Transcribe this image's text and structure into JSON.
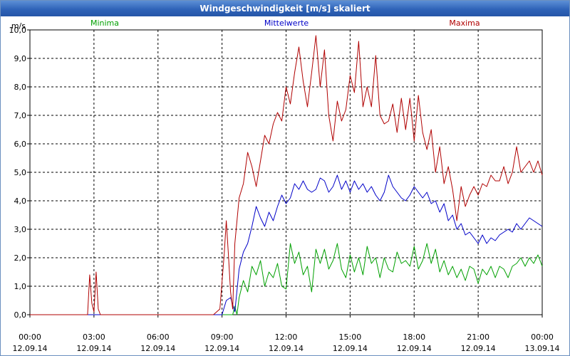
{
  "window": {
    "title": "Windgeschwindigkeit [m/s] skaliert"
  },
  "chart_data": {
    "type": "line",
    "title": "Windgeschwindigkeit [m/s] skaliert",
    "ylabel": "m/s",
    "ylim": [
      0,
      10
    ],
    "xlim": [
      0,
      24
    ],
    "grid": true,
    "legend_placement": "top",
    "y_ticks": [
      "0,0",
      "1,0",
      "2,0",
      "3,0",
      "4,0",
      "5,0",
      "6,0",
      "7,0",
      "8,0",
      "9,0",
      "10,0"
    ],
    "x_ticks": [
      {
        "time": "00:00",
        "date": "12.09.14"
      },
      {
        "time": "03:00",
        "date": "12.09.14"
      },
      {
        "time": "06:00",
        "date": "12.09.14"
      },
      {
        "time": "09:00",
        "date": "12.09.14"
      },
      {
        "time": "12:00",
        "date": "12.09.14"
      },
      {
        "time": "15:00",
        "date": "12.09.14"
      },
      {
        "time": "18:00",
        "date": "12.09.14"
      },
      {
        "time": "21:00",
        "date": "12.09.14"
      },
      {
        "time": "00:00",
        "date": "13.09.14"
      }
    ],
    "series": [
      {
        "name": "Minima",
        "color": "#00a000",
        "x": [
          0,
          9.3,
          9.5,
          9.6,
          9.7,
          9.8,
          10.0,
          10.2,
          10.4,
          10.6,
          10.8,
          11.0,
          11.2,
          11.4,
          11.6,
          11.8,
          12.0,
          12.2,
          12.4,
          12.6,
          12.8,
          13.0,
          13.2,
          13.4,
          13.6,
          13.8,
          14.0,
          14.2,
          14.4,
          14.6,
          14.8,
          15.0,
          15.2,
          15.4,
          15.6,
          15.8,
          16.0,
          16.2,
          16.4,
          16.6,
          16.8,
          17.0,
          17.2,
          17.4,
          17.6,
          17.8,
          18.0,
          18.2,
          18.4,
          18.6,
          18.8,
          19.0,
          19.2,
          19.4,
          19.6,
          19.8,
          20.0,
          20.2,
          20.4,
          20.6,
          20.8,
          21.0,
          21.2,
          21.4,
          21.6,
          21.8,
          22.0,
          22.2,
          22.4,
          22.6,
          22.8,
          23.0,
          23.2,
          23.4,
          23.6,
          23.8,
          24.0
        ],
        "values": [
          0,
          0,
          0,
          0.3,
          0,
          0.6,
          1.2,
          0.8,
          1.7,
          1.4,
          1.9,
          1.0,
          1.5,
          1.3,
          1.8,
          1.0,
          0.9,
          2.5,
          1.8,
          2.2,
          1.4,
          1.7,
          0.8,
          2.3,
          1.8,
          2.3,
          1.6,
          1.9,
          2.5,
          1.6,
          1.3,
          2.1,
          1.5,
          2.0,
          1.4,
          2.4,
          1.8,
          2.0,
          1.3,
          2.0,
          1.6,
          1.5,
          2.2,
          1.8,
          1.9,
          1.7,
          2.4,
          1.6,
          1.9,
          2.5,
          1.8,
          2.3,
          1.5,
          1.9,
          1.4,
          1.7,
          1.3,
          1.6,
          1.2,
          1.7,
          1.6,
          1.1,
          1.6,
          1.4,
          1.7,
          1.3,
          1.7,
          1.6,
          1.3,
          1.7,
          1.8,
          2.0,
          1.7,
          2.0,
          1.8,
          2.1,
          1.7
        ]
      },
      {
        "name": "Mittelwerte",
        "color": "#0000c8",
        "x": [
          0,
          9.0,
          9.2,
          9.4,
          9.6,
          9.8,
          10.0,
          10.2,
          10.4,
          10.6,
          10.8,
          11.0,
          11.2,
          11.4,
          11.6,
          11.8,
          12.0,
          12.2,
          12.4,
          12.6,
          12.8,
          13.0,
          13.2,
          13.4,
          13.6,
          13.8,
          14.0,
          14.2,
          14.4,
          14.6,
          14.8,
          15.0,
          15.2,
          15.4,
          15.6,
          15.8,
          16.0,
          16.2,
          16.4,
          16.6,
          16.8,
          17.0,
          17.2,
          17.4,
          17.6,
          17.8,
          18.0,
          18.2,
          18.4,
          18.6,
          18.8,
          19.0,
          19.2,
          19.4,
          19.6,
          19.8,
          20.0,
          20.2,
          20.4,
          20.6,
          20.8,
          21.0,
          21.2,
          21.4,
          21.6,
          21.8,
          22.0,
          22.2,
          22.4,
          22.6,
          22.8,
          23.0,
          23.2,
          23.4,
          23.6,
          23.8,
          24.0
        ],
        "values": [
          0,
          0,
          0.5,
          0.6,
          0.1,
          1.6,
          2.2,
          2.5,
          3.1,
          3.8,
          3.4,
          3.1,
          3.6,
          3.3,
          3.8,
          4.2,
          3.9,
          4.1,
          4.6,
          4.4,
          4.7,
          4.4,
          4.3,
          4.4,
          4.8,
          4.7,
          4.3,
          4.5,
          4.9,
          4.4,
          4.7,
          4.3,
          4.7,
          4.4,
          4.6,
          4.3,
          4.5,
          4.2,
          4.0,
          4.3,
          4.9,
          4.5,
          4.3,
          4.1,
          4.0,
          4.2,
          4.5,
          4.3,
          4.1,
          4.3,
          3.9,
          4.0,
          3.6,
          3.9,
          3.3,
          3.5,
          3.0,
          3.2,
          2.8,
          2.9,
          2.7,
          2.5,
          2.8,
          2.5,
          2.7,
          2.6,
          2.8,
          2.9,
          3.0,
          2.9,
          3.2,
          3.0,
          3.2,
          3.4,
          3.3,
          3.2,
          3.1
        ]
      },
      {
        "name": "Maxima",
        "color": "#b00000",
        "x": [
          0,
          2.7,
          2.8,
          2.9,
          3.0,
          3.1,
          3.2,
          3.3,
          8.6,
          8.9,
          9.1,
          9.2,
          9.3,
          9.4,
          9.5,
          9.6,
          9.8,
          10.0,
          10.2,
          10.4,
          10.6,
          10.8,
          11.0,
          11.2,
          11.4,
          11.6,
          11.8,
          12.0,
          12.2,
          12.4,
          12.6,
          12.8,
          13.0,
          13.2,
          13.4,
          13.6,
          13.8,
          14.0,
          14.2,
          14.4,
          14.6,
          14.8,
          15.0,
          15.2,
          15.4,
          15.6,
          15.8,
          16.0,
          16.2,
          16.4,
          16.6,
          16.8,
          17.0,
          17.2,
          17.4,
          17.6,
          17.8,
          18.0,
          18.2,
          18.4,
          18.6,
          18.8,
          19.0,
          19.2,
          19.4,
          19.6,
          19.8,
          20.0,
          20.2,
          20.4,
          20.6,
          20.8,
          21.0,
          21.2,
          21.4,
          21.6,
          21.8,
          22.0,
          22.2,
          22.4,
          22.6,
          22.8,
          23.0,
          23.2,
          23.4,
          23.6,
          23.8,
          24.0
        ],
        "values": [
          0,
          0,
          1.4,
          0.4,
          0.1,
          1.5,
          0.2,
          0,
          0,
          0.2,
          2.1,
          3.3,
          2.1,
          0.8,
          0.2,
          2.5,
          4.1,
          4.6,
          5.7,
          5.2,
          4.5,
          5.4,
          6.3,
          6.0,
          6.7,
          7.1,
          6.8,
          8.0,
          7.4,
          8.5,
          9.4,
          8.2,
          7.3,
          8.5,
          9.8,
          8.0,
          9.3,
          7.0,
          6.1,
          7.5,
          6.8,
          7.2,
          8.4,
          7.8,
          9.6,
          7.3,
          8.0,
          7.3,
          9.1,
          7.0,
          6.7,
          6.8,
          7.4,
          6.4,
          7.6,
          6.5,
          7.6,
          6.1,
          7.7,
          6.4,
          5.8,
          6.5,
          5.0,
          5.9,
          4.6,
          5.2,
          4.4,
          3.3,
          4.5,
          3.8,
          4.2,
          4.5,
          4.2,
          4.6,
          4.5,
          4.9,
          4.7,
          4.7,
          5.2,
          4.6,
          5.0,
          5.9,
          5.0,
          5.2,
          5.4,
          5.0,
          5.4,
          4.9
        ]
      }
    ]
  }
}
